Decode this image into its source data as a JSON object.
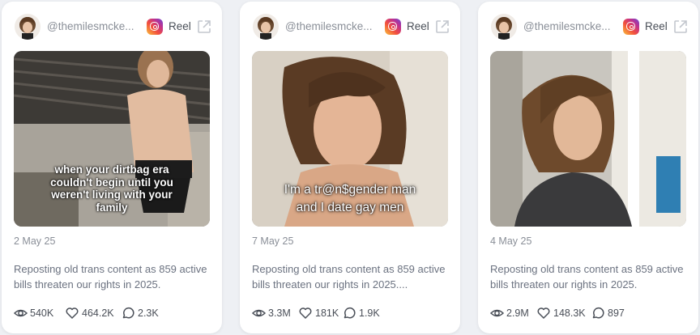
{
  "posts": [
    {
      "handle": "@themilesmcke...",
      "platform": "Reel",
      "platform_icon": "instagram-icon",
      "caption": [
        "when your dirtbag era",
        "couldn't begin until you",
        "weren't living with your",
        "family"
      ],
      "date": "2 May 25",
      "description": "Reposting old trans content as 859 active bills threaten our rights in 2025.",
      "views": "540K",
      "likes": "464.2K",
      "comments": "2.3K"
    },
    {
      "handle": "@themilesmcke...",
      "platform": "Reel",
      "platform_icon": "instagram-icon",
      "caption": [
        "I'm a tr@n$gender man",
        "and I date gay men"
      ],
      "date": "7 May 25",
      "description": "Reposting old trans content as 859 active bills threaten our rights in 2025....",
      "views": "3.3M",
      "likes": "181K",
      "comments": "1.9K"
    },
    {
      "handle": "@themilesmcke...",
      "platform": "Reel",
      "platform_icon": "instagram-icon",
      "caption": [],
      "date": "4 May 25",
      "description": "Reposting old trans content as 859 active bills threaten our rights in 2025.",
      "views": "2.9M",
      "likes": "148.3K",
      "comments": "897"
    }
  ]
}
